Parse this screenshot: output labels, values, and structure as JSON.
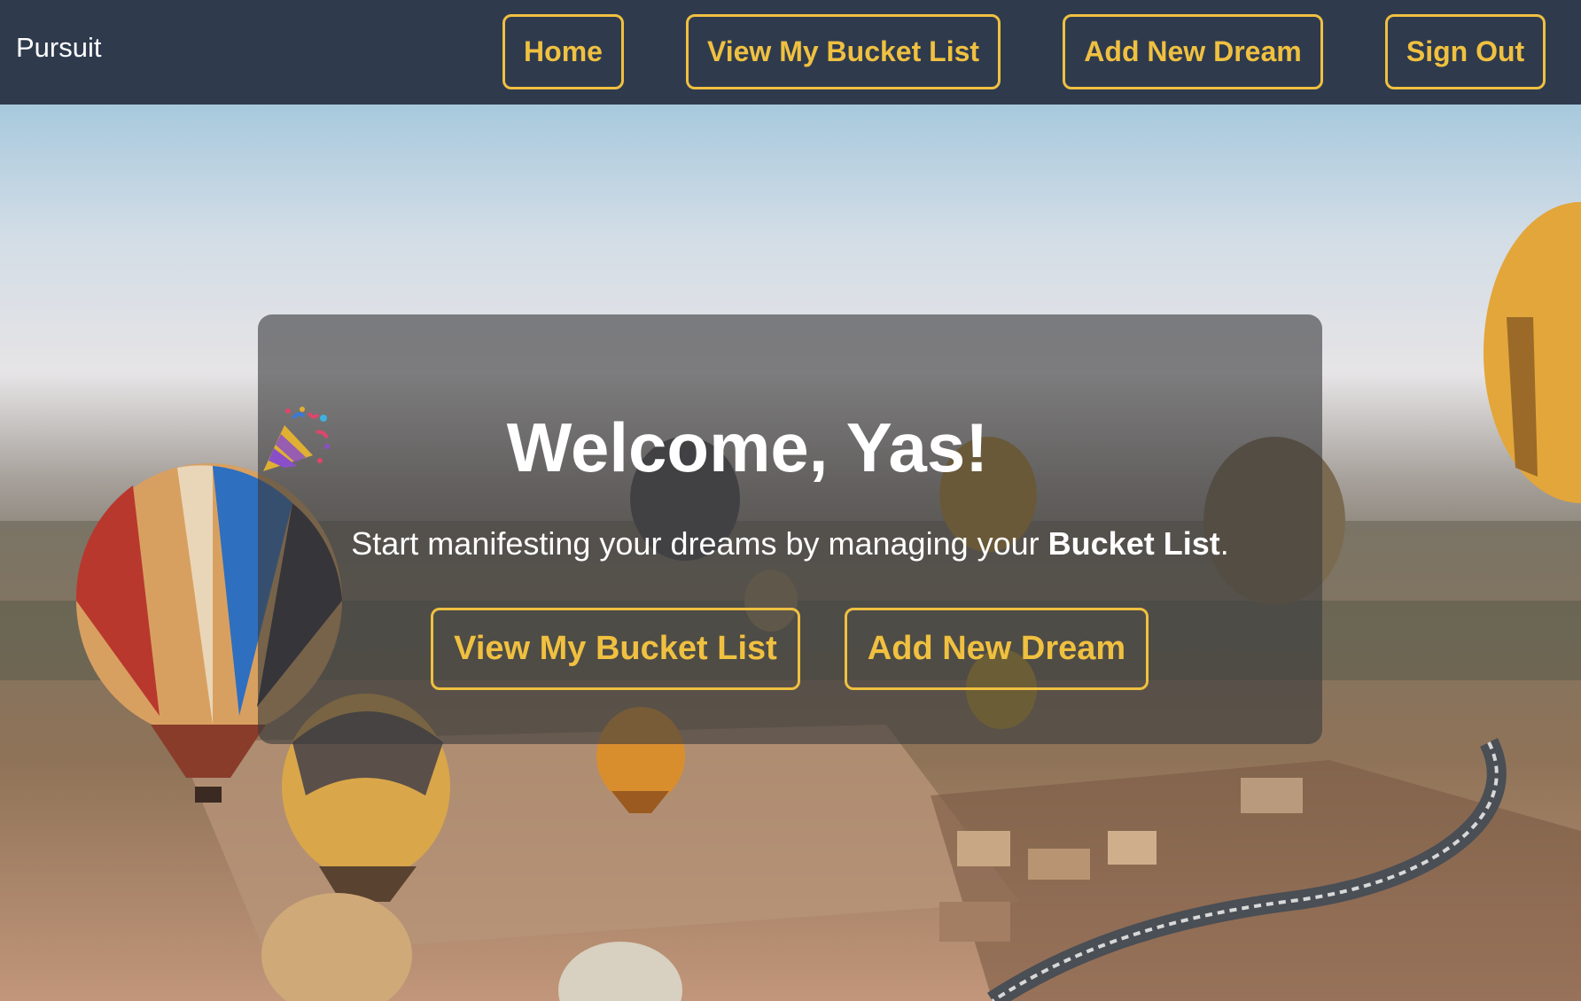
{
  "navbar": {
    "brand": "Pursuit",
    "links": [
      {
        "label": "Home"
      },
      {
        "label": "View My Bucket List"
      },
      {
        "label": "Add New Dream"
      },
      {
        "label": "Sign Out"
      }
    ]
  },
  "hero": {
    "background_image": "hot-air-balloons-over-desert-valley",
    "welcome": {
      "title": "Welcome, Yas!",
      "icon": "party-popper-icon"
    },
    "subtitle": {
      "prefix": "Start manifesting your dreams by managing your ",
      "emphasis": "Bucket List",
      "suffix": "."
    },
    "buttons": [
      {
        "label": "View My Bucket List"
      },
      {
        "label": "Add New Dream"
      }
    ]
  },
  "colors": {
    "navbar_bg": "#2f3b4d",
    "accent": "#f0c040",
    "text": "#ffffff",
    "card_overlay": "rgba(60,60,62,0.62)"
  }
}
